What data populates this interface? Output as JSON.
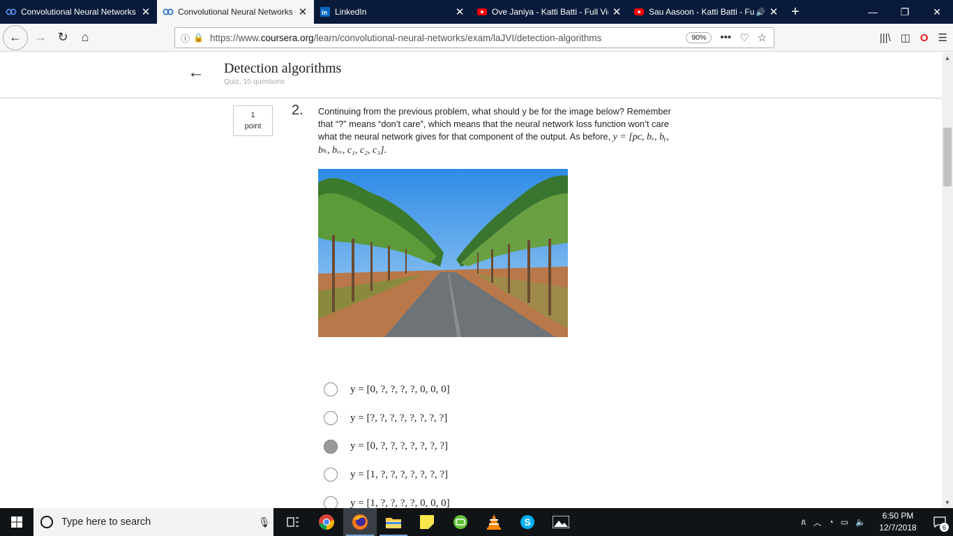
{
  "browser": {
    "tabs": [
      {
        "title": "Convolutional Neural Networks",
        "icon": "coursera-icon",
        "active": false,
        "audio": false
      },
      {
        "title": "Convolutional Neural Networks",
        "icon": "coursera-icon",
        "active": true,
        "audio": false
      },
      {
        "title": "LinkedIn",
        "icon": "linkedin-icon",
        "active": false,
        "audio": false
      },
      {
        "title": "Ove Janiya - Katti Batti - Full Vid",
        "icon": "youtube-icon",
        "active": false,
        "audio": false
      },
      {
        "title": "Sau Aasoon - Katti Batti - Full",
        "icon": "youtube-icon",
        "active": false,
        "audio": true
      }
    ],
    "url_prefix": "https://www.",
    "url_domain": "coursera.org",
    "url_path": "/learn/convolutional-neural-networks/exam/laJVI/detection-algorithms",
    "zoom": "90%"
  },
  "quiz": {
    "title": "Detection algorithms",
    "subtitle": "Quiz, 10 questions",
    "question": {
      "number": "2.",
      "points_value": "1",
      "points_label": "point",
      "text_line1": "Continuing from the previous problem, what should y be for the image below? Remember that “?” means “don’t care”, which means that the neural network loss function won’t care what the neural network gives for that component of the output. As before,",
      "text_math": "y = [pᴄ, bₓ, bᵧ, bₕ, bᵥᵥ, c₁, c₂, c₃].",
      "options": [
        {
          "label": "y = [0, ?, ?, ?, ?, 0, 0, 0]",
          "selected": false
        },
        {
          "label": "y = [?, ?, ?, ?, ?, ?, ?, ?]",
          "selected": false
        },
        {
          "label": "y = [0, ?, ?, ?, ?, ?, ?, ?]",
          "selected": true
        },
        {
          "label": "y = [1, ?, ?, ?, ?, ?, ?, ?]",
          "selected": false
        },
        {
          "label": "y = [1, ?, ?, ?, ?, 0, 0, 0]",
          "selected": false
        }
      ]
    }
  },
  "taskbar": {
    "search_placeholder": "Type here to search",
    "time": "6:50 PM",
    "date": "12/7/2018",
    "notification_count": "6"
  }
}
